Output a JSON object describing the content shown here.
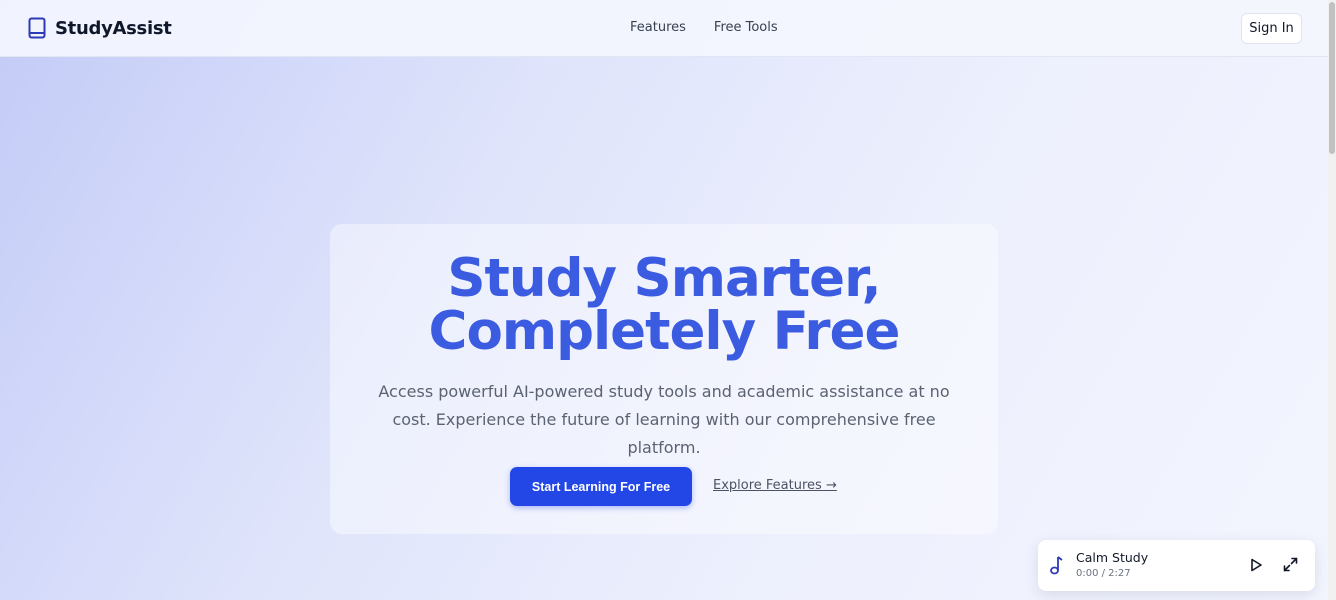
{
  "header": {
    "brand_name": "StudyAssist",
    "brand_icon": "book-icon",
    "nav": [
      {
        "label": "Features"
      },
      {
        "label": "Free Tools"
      }
    ],
    "signin_label": "Sign In"
  },
  "hero": {
    "title_line1": "Study Smarter,",
    "title_line2": "Completely Free",
    "subtitle": "Access powerful AI-powered study tools and academic assistance at no cost. Experience the future of learning with our comprehensive free platform.",
    "primary_cta": "Start Learning For Free",
    "secondary_cta": "Explore Features →"
  },
  "player": {
    "icon": "music-note-icon",
    "track_title": "Calm Study",
    "time": "0:00 / 2:27",
    "play_icon": "play-icon",
    "expand_icon": "expand-icon"
  },
  "colors": {
    "accent": "#3b5be0",
    "button": "#2347e6",
    "brand_icon": "#2b3bb5"
  }
}
